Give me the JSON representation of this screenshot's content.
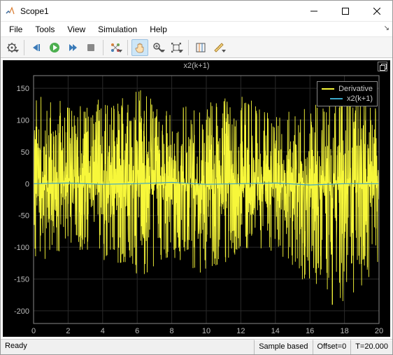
{
  "window": {
    "title": "Scope1"
  },
  "menu": {
    "items": [
      "File",
      "Tools",
      "View",
      "Simulation",
      "Help"
    ]
  },
  "toolbar": {
    "buttons": [
      {
        "name": "settings-icon",
        "drop": true
      },
      "sep",
      {
        "name": "step-back-icon"
      },
      {
        "name": "run-icon"
      },
      {
        "name": "step-forward-icon"
      },
      {
        "name": "stop-icon"
      },
      "sep",
      {
        "name": "signals-icon",
        "drop": true
      },
      "sep",
      {
        "name": "pan-icon",
        "selected": true
      },
      {
        "name": "zoom-icon",
        "drop": true
      },
      {
        "name": "scale-icon",
        "drop": true
      },
      "sep",
      {
        "name": "cursor-icon"
      },
      {
        "name": "measure-icon",
        "drop": true
      }
    ]
  },
  "plot": {
    "title": "x2(k+1)",
    "legend": [
      {
        "label": "Derivative",
        "color": "#f7f73a"
      },
      {
        "label": "x2(k+1)",
        "color": "#3aa8c9"
      }
    ]
  },
  "chart_data": {
    "type": "line",
    "title": "x2(k+1)",
    "xlabel": "",
    "ylabel": "",
    "xlim": [
      0,
      20
    ],
    "ylim": [
      -220,
      170
    ],
    "xticks": [
      0,
      2,
      4,
      6,
      8,
      10,
      12,
      14,
      16,
      18,
      20
    ],
    "yticks": [
      -200,
      -150,
      -100,
      -50,
      0,
      50,
      100,
      150
    ],
    "grid": true,
    "legend_position": "top-right",
    "series": [
      {
        "name": "Derivative",
        "color": "#f7f73a",
        "description": "High-frequency noisy signal oscillating around zero. Dense spikes fill roughly ±50 continuously across x=0..20, with frequent excursions to ±100 and occasional spikes reaching about +150 and -150. A single downward spike near x≈17.3 reaches approximately -190.",
        "x_range": [
          0,
          20
        ],
        "approx_envelope_upper": [
          140,
          130,
          140,
          150,
          120,
          130,
          140,
          110,
          120,
          150,
          130
        ],
        "approx_envelope_lower": [
          -140,
          -100,
          -120,
          -150,
          -120,
          -150,
          -110,
          -120,
          -160,
          -190,
          -130
        ],
        "mean": 0
      },
      {
        "name": "x2(k+1)",
        "color": "#3aa8c9",
        "description": "Near-flat line close to y=0 with very small fluctuations, largely obscured behind the yellow Derivative series.",
        "x": [
          0,
          2,
          4,
          6,
          8,
          10,
          12,
          14,
          16,
          18,
          20
        ],
        "values": [
          0,
          1,
          -1,
          0,
          2,
          -1,
          0,
          1,
          -2,
          0,
          0
        ]
      }
    ]
  },
  "status": {
    "ready": "Ready",
    "mode": "Sample based",
    "offset": "Offset=0",
    "time": "T=20.000"
  },
  "colors": {
    "plot_bg": "#000000",
    "grid": "#333333",
    "axis_text": "#bcbcbc"
  }
}
